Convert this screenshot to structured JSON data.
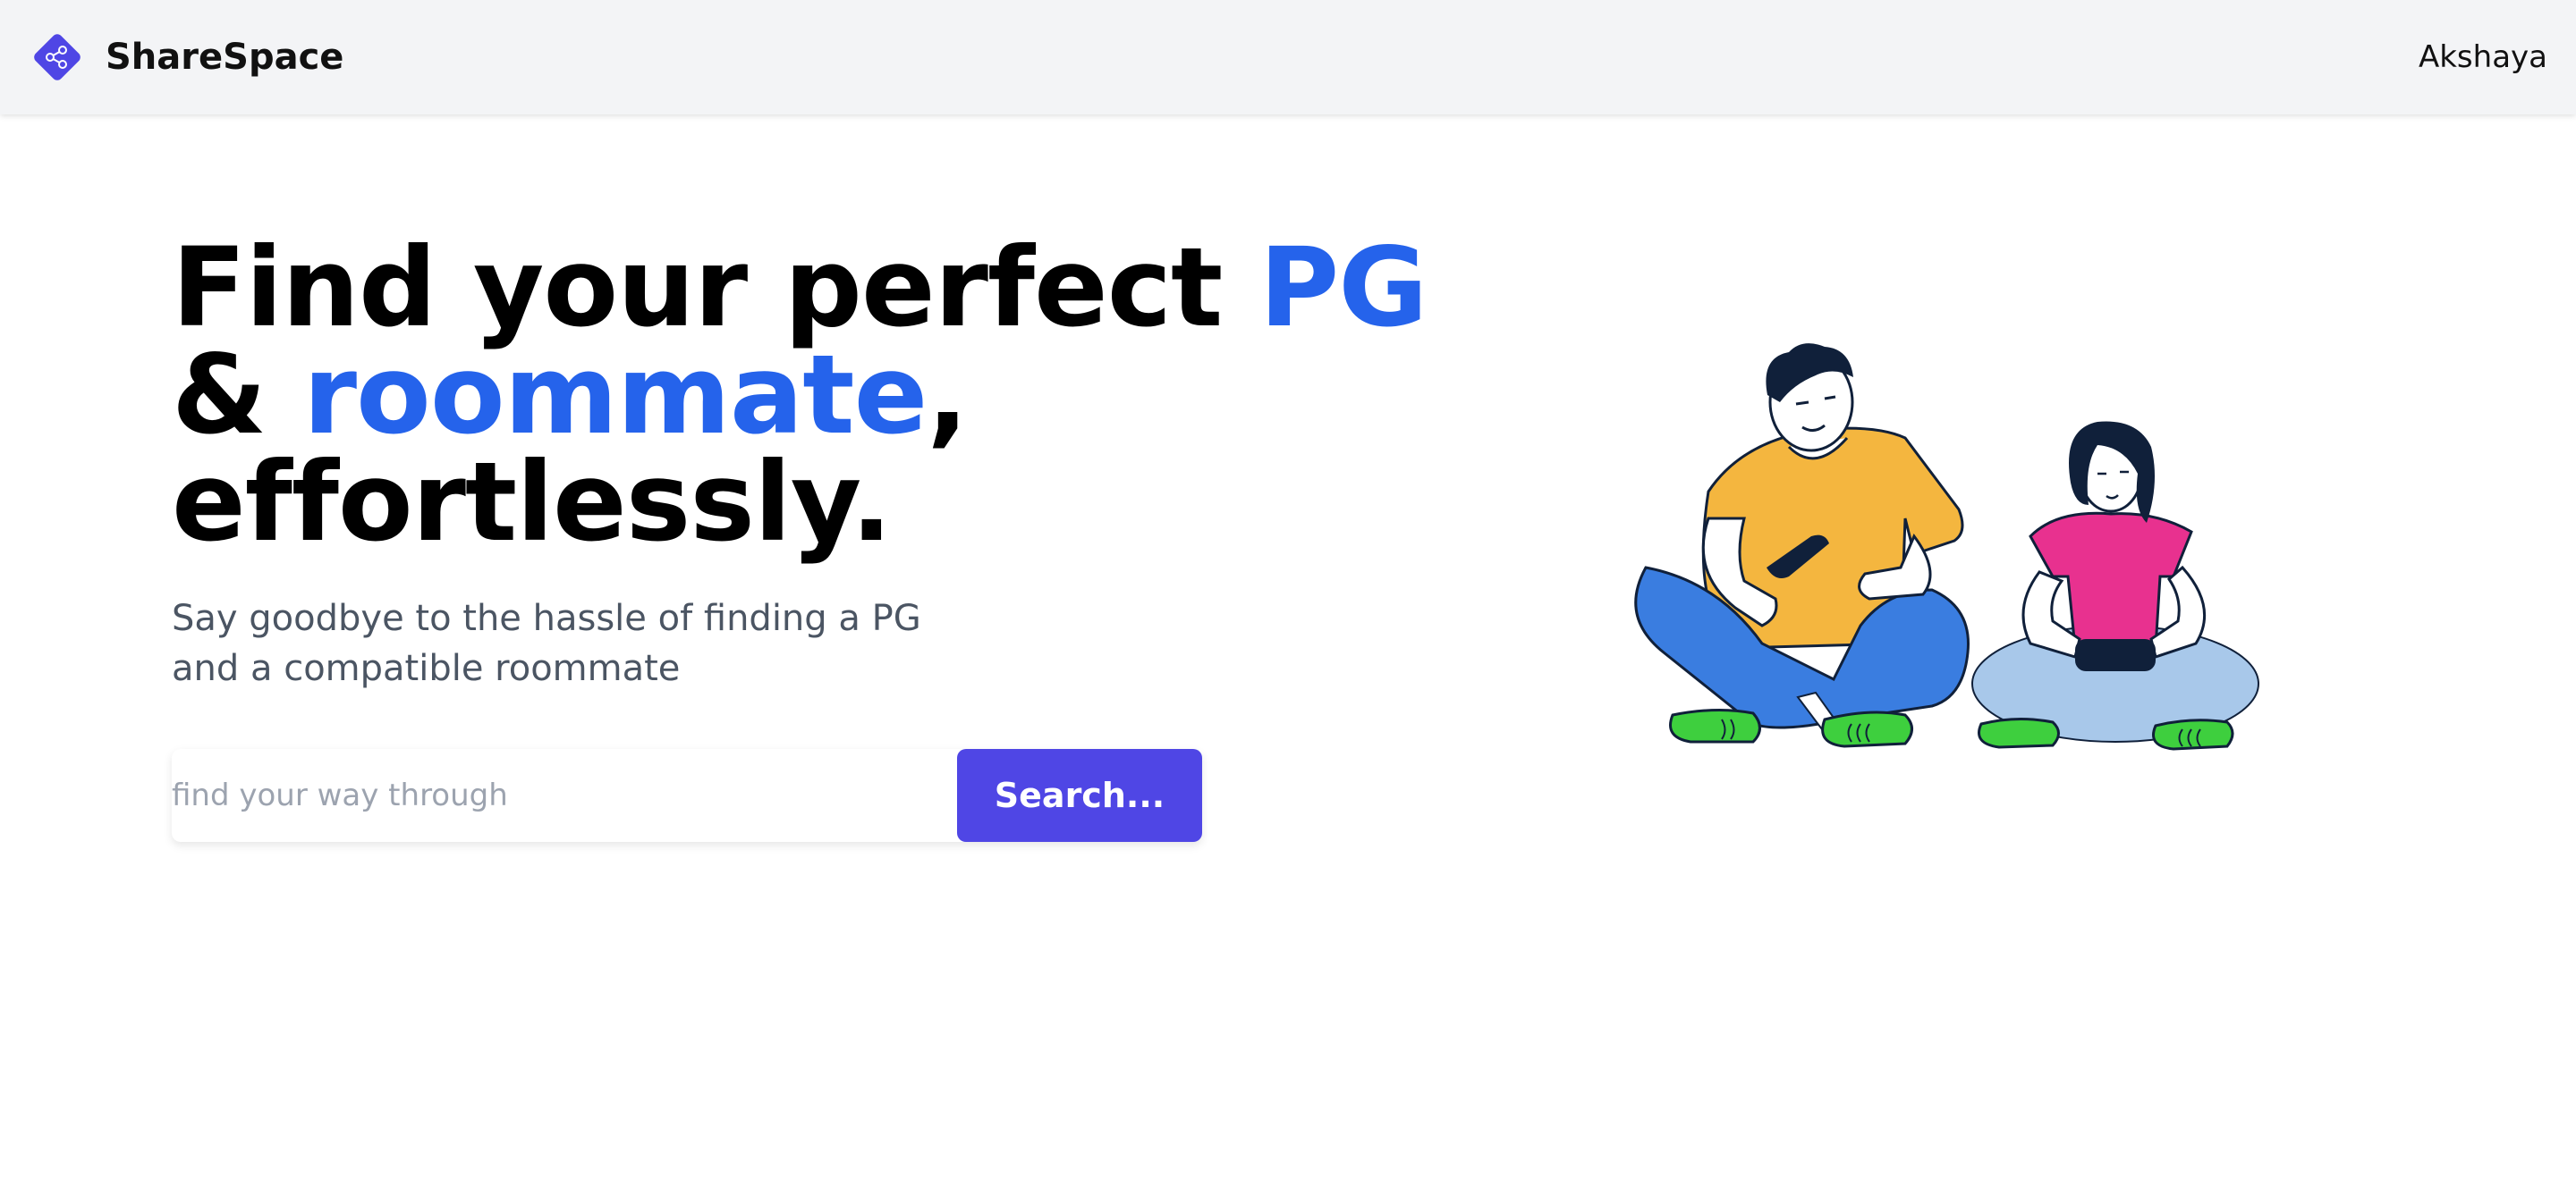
{
  "navbar": {
    "brand": "ShareSpace",
    "user_name": "Akshaya",
    "logo_icon": "share-icon",
    "brand_color": "#4f46e5"
  },
  "hero": {
    "title_part1": "Find your perfect ",
    "title_highlight1": "PG",
    "title_part2": "& ",
    "title_highlight2": "roommate",
    "title_part3": ",",
    "title_part4": "effortlessly.",
    "highlight_color": "#2563eb",
    "subtitle_line1": "Say goodbye to the hassle of finding a PG",
    "subtitle_line2": "and a compatible roommate"
  },
  "search": {
    "placeholder": "find your way through",
    "value": "",
    "button_label": "Search..."
  },
  "illustration": {
    "icon": "friends-playing-games-illustration"
  }
}
